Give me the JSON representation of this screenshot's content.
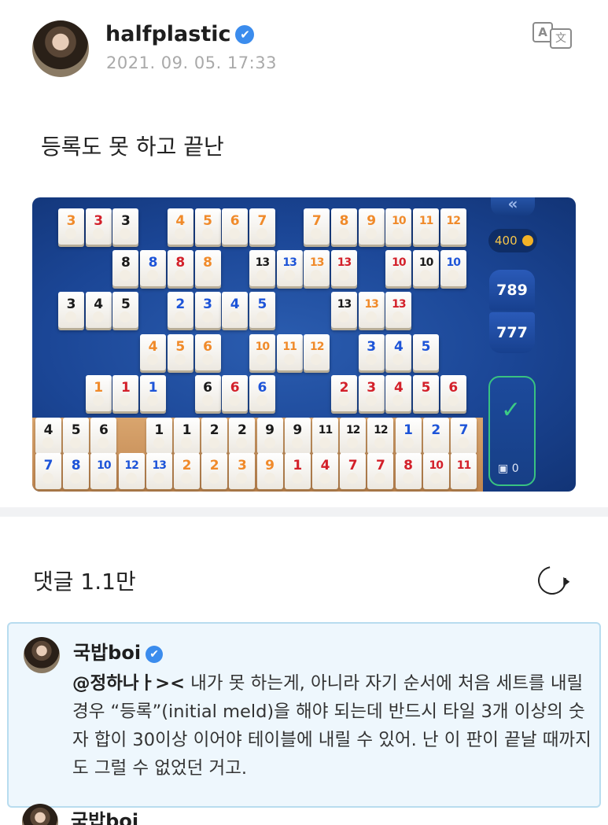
{
  "post": {
    "username": "halfplastic",
    "verified_mark": "✔",
    "timestamp": "2021. 09. 05. 17:33",
    "translate_icon_a": "A",
    "translate_icon_b": "文",
    "text": "등록도 못 하고 끝난"
  },
  "game": {
    "score_badge": "400",
    "counter_top": "789",
    "counter_bottom": "777",
    "pool_count": "0",
    "arrows": "«",
    "confirm_glyph": "✓",
    "board_rows": [
      [
        "3o",
        "3r",
        "3k",
        "_",
        "4o",
        "5o",
        "6o",
        "7o",
        "_",
        "7o",
        "8o",
        "9o",
        "10o",
        "11o",
        "12o"
      ],
      [
        "_",
        "_",
        "8k",
        "8b",
        "8r",
        "8o",
        "_",
        "13k",
        "13b",
        "13o",
        "13r",
        "_",
        "10r",
        "10k",
        "10b"
      ],
      [
        "3k",
        "4k",
        "5k",
        "_",
        "2b",
        "3b",
        "4b",
        "5b",
        "_",
        "_",
        "13k",
        "13o",
        "13r"
      ],
      [
        "_",
        "_",
        "_",
        "4o",
        "5o",
        "6o",
        "_",
        "10o",
        "11o",
        "12o",
        "_",
        "3b",
        "4b",
        "5b"
      ],
      [
        "_",
        "1o",
        "1r",
        "1b",
        "_",
        "6k",
        "6r",
        "6b",
        "_",
        "_",
        "2r",
        "3r",
        "4r",
        "5r",
        "6r"
      ]
    ],
    "rack_rows": [
      [
        "4k",
        "5k",
        "6k",
        "_",
        "1k",
        "1k",
        "2k",
        "2k",
        "9k",
        "9k",
        "11k",
        "12k",
        "12k",
        "1b",
        "2b",
        "7b"
      ],
      [
        "7b",
        "8b",
        "10b",
        "12b",
        "13b",
        "2o",
        "2o",
        "3o",
        "9o",
        "1r",
        "4r",
        "7r",
        "7r",
        "8r",
        "10r",
        "11r"
      ]
    ]
  },
  "comments": {
    "label": "댓글 1.1만",
    "items": [
      {
        "author": "국밥boi",
        "mention": "@정하나ㅏ><",
        "body": " 내가 못 하는게, 아니라 자기 순서에 처음 세트를 내릴 경우 “등록”(initial meld)을 해야 되는데 반드시 타일 3개 이상의 숫자 합이 30이상 이어야 테이블에 내릴 수 있어. 난 이 판이 끝날 때까지도 그럴 수 없었던 거고."
      }
    ],
    "next_author": "국밥boi"
  }
}
